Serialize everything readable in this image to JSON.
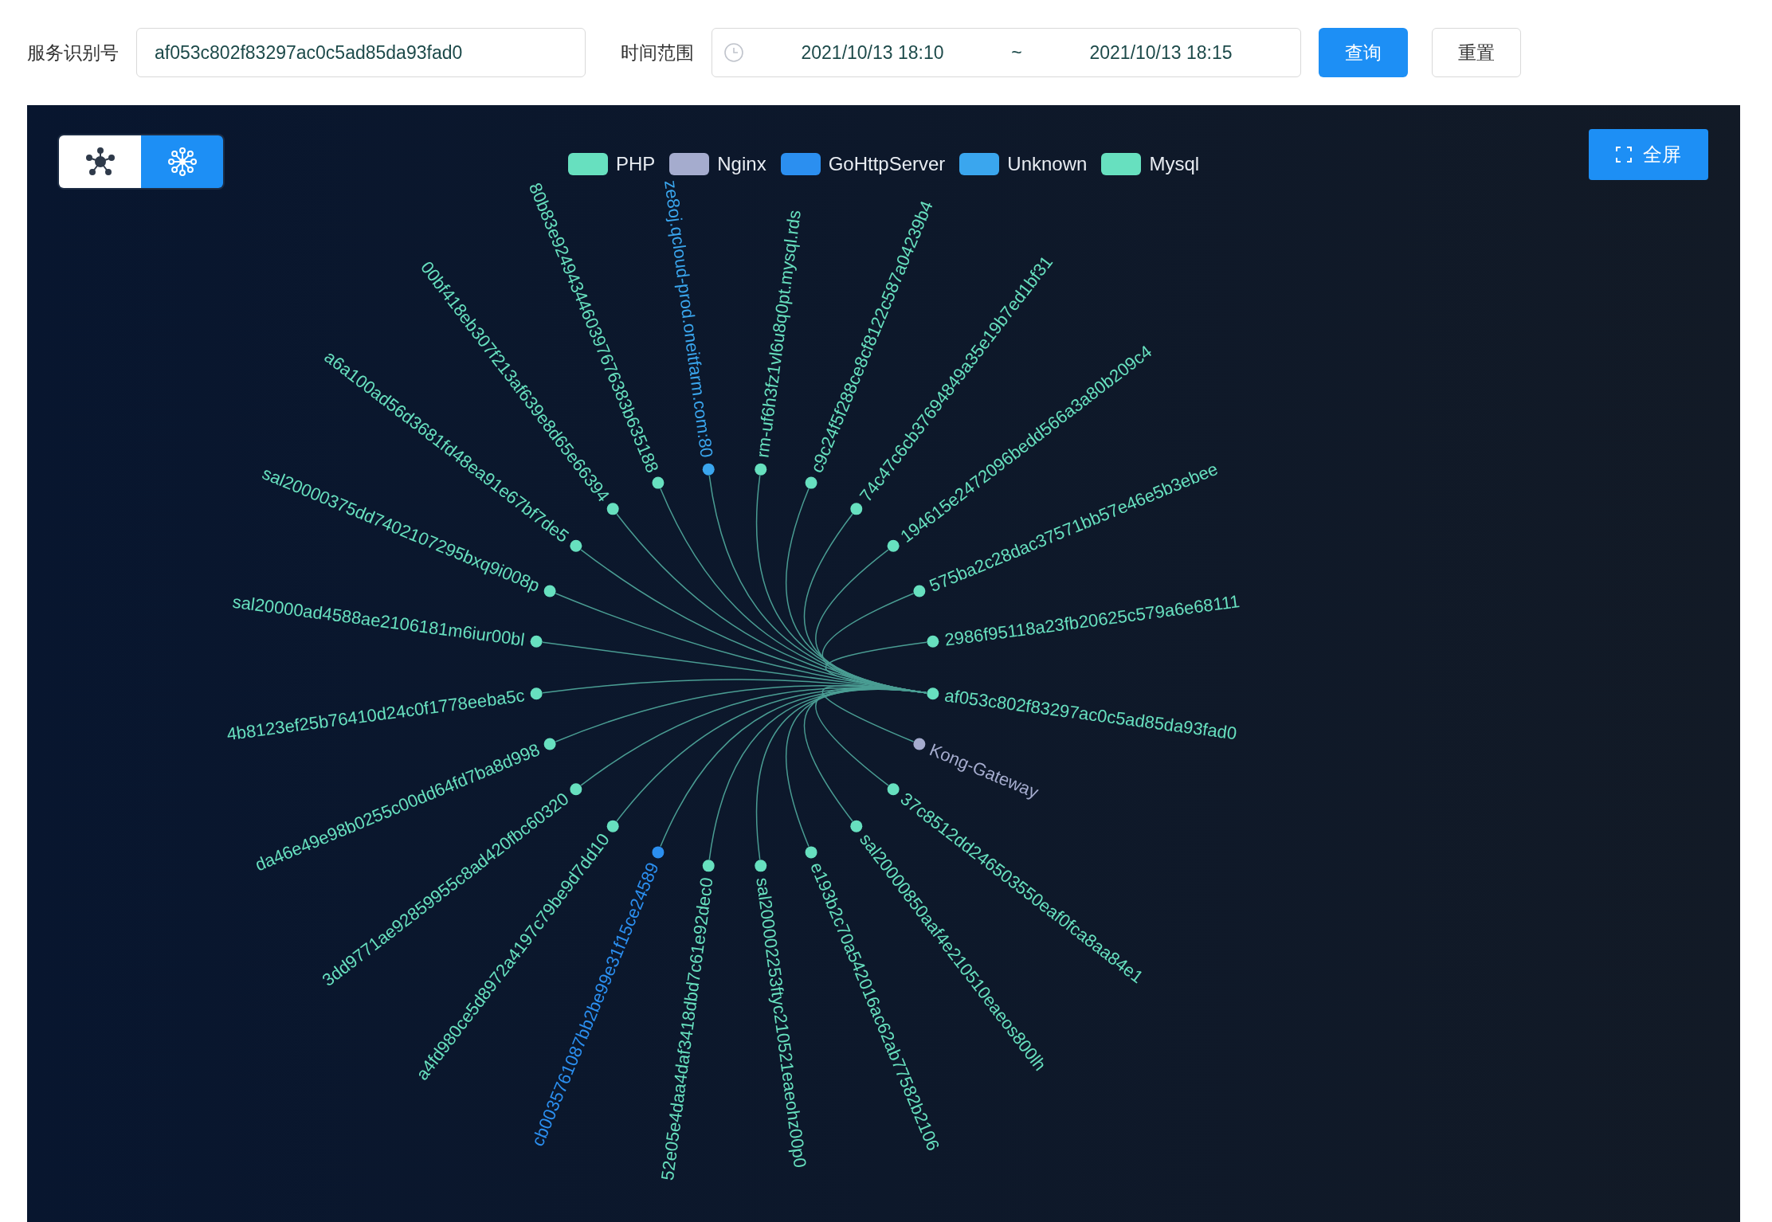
{
  "filter": {
    "service_label": "服务识别号",
    "service_value": "af053c802f83297ac0c5ad85da93fad0",
    "time_label": "时间范围",
    "start": "2021/10/13 18:10",
    "separator": "~",
    "end": "2021/10/13 18:15",
    "query_button": "查询",
    "reset_button": "重置"
  },
  "view_toggle": [
    {
      "kind": "graph",
      "selected": false
    },
    {
      "kind": "tree",
      "selected": true
    }
  ],
  "fullscreen_button": "全屏",
  "legend": [
    {
      "name": "PHP",
      "color": "#67e0bf"
    },
    {
      "name": "Nginx",
      "color": "#a5acce"
    },
    {
      "name": "GoHttpServer",
      "color": "#2b8ff0"
    },
    {
      "name": "Unknown",
      "color": "#3aa6ee"
    },
    {
      "name": "Mysql",
      "color": "#67e0bf"
    }
  ],
  "tree": {
    "root": {
      "label": "af053c802f83297ac0c5ad85da93fad0",
      "color": "#67e0bf"
    },
    "children": [
      {
        "label": "Kong-Gateway",
        "color": "#a5acce"
      },
      {
        "label": "37c8512dd246503550eaf0fca8aa84e1",
        "color": "#67e0bf"
      },
      {
        "label": "sal20000850aaf4e210510eaeos800lh",
        "color": "#67e0bf"
      },
      {
        "label": "e193b2c70a542016ac62ab77582b2106",
        "color": "#67e0bf"
      },
      {
        "label": "sal200002253ftyc210521eaeohz00p0",
        "color": "#67e0bf"
      },
      {
        "label": "52e05e4daa4daf3418dbd7c61e92dec0",
        "color": "#67e0bf"
      },
      {
        "label": "cb0035761087bb2be99e31f15ce24589",
        "color": "#2b8ff0"
      },
      {
        "label": "a4fd980ce5d8972a4197c79be9d7dd10",
        "color": "#67e0bf"
      },
      {
        "label": "3dd9771ae92859955c8ad420fbc60320",
        "color": "#67e0bf"
      },
      {
        "label": "da46e49e98b0255c00dd64fd7ba8d998",
        "color": "#67e0bf"
      },
      {
        "label": "4b8123ef25b76410d24c0f1778eeba5c",
        "color": "#67e0bf"
      },
      {
        "label": "sal20000ad4588ae2106181m6iur00bl",
        "color": "#67e0bf"
      },
      {
        "label": "sal20000375dd7402107295bxq9i008p",
        "color": "#67e0bf"
      },
      {
        "label": "a6a100ad56d3681fd48ea91e67bf7de5",
        "color": "#67e0bf"
      },
      {
        "label": "00bf418eb307f213af639e8d65e66394",
        "color": "#67e0bf"
      },
      {
        "label": "80b83e9249434460397676383b635188",
        "color": "#67e0bf"
      },
      {
        "label": "ze8oj.qcloud-prod.oneitfarm.com:80",
        "color": "#3aa6ee"
      },
      {
        "label": "rm-uf6h3fz1vl6u8q0pt.mysql.rds",
        "color": "#67e0bf"
      },
      {
        "label": "c9c24f5f288ce8cf8122c587a04239b4",
        "color": "#67e0bf"
      },
      {
        "label": "74c47c6cb37694849a35e19b7ed1bf31",
        "color": "#67e0bf"
      },
      {
        "label": "194615e2472096bedd566a3a80b209c4",
        "color": "#67e0bf"
      },
      {
        "label": "575ba2c28dac37571bb57e46e5b3ebee",
        "color": "#67e0bf"
      },
      {
        "label": "2986f95118a23fb20625c579a6e68111",
        "color": "#67e0bf"
      }
    ]
  }
}
